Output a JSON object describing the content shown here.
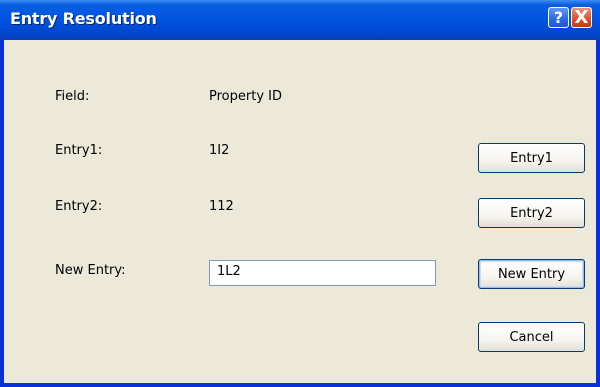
{
  "window": {
    "title": "Entry Resolution"
  },
  "titlebar_buttons": {
    "help": "?",
    "close": "X"
  },
  "fields": {
    "field_label": "Field:",
    "field_value": "Property ID",
    "entry1_label": "Entry1:",
    "entry1_value": "1I2",
    "entry2_label": "Entry2:",
    "entry2_value": "112",
    "new_entry_label": "New Entry:",
    "new_entry_value": "1L2"
  },
  "buttons": {
    "entry1": "Entry1",
    "entry2": "Entry2",
    "new_entry": "New Entry",
    "cancel": "Cancel"
  },
  "colors": {
    "titlebar": "#0054e3",
    "frame": "#0831d9",
    "dialog_bg": "#ece9d8"
  }
}
